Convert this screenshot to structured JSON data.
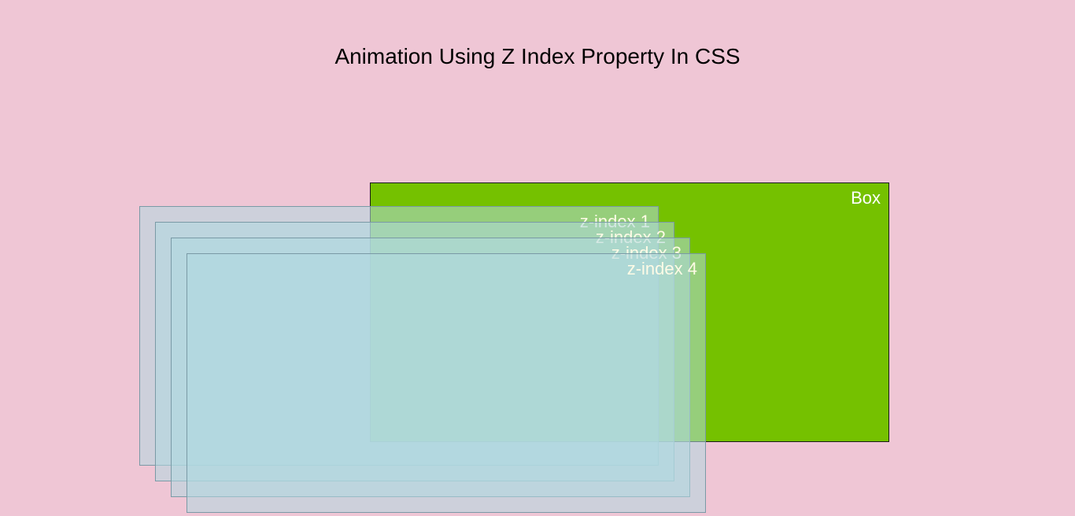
{
  "title": "Animation Using Z Index Property In CSS",
  "box": {
    "label": "Box"
  },
  "layers": [
    {
      "label": "z-index 1"
    },
    {
      "label": "z-index 2"
    },
    {
      "label": "z-index 3"
    },
    {
      "label": "z-index 4"
    }
  ]
}
